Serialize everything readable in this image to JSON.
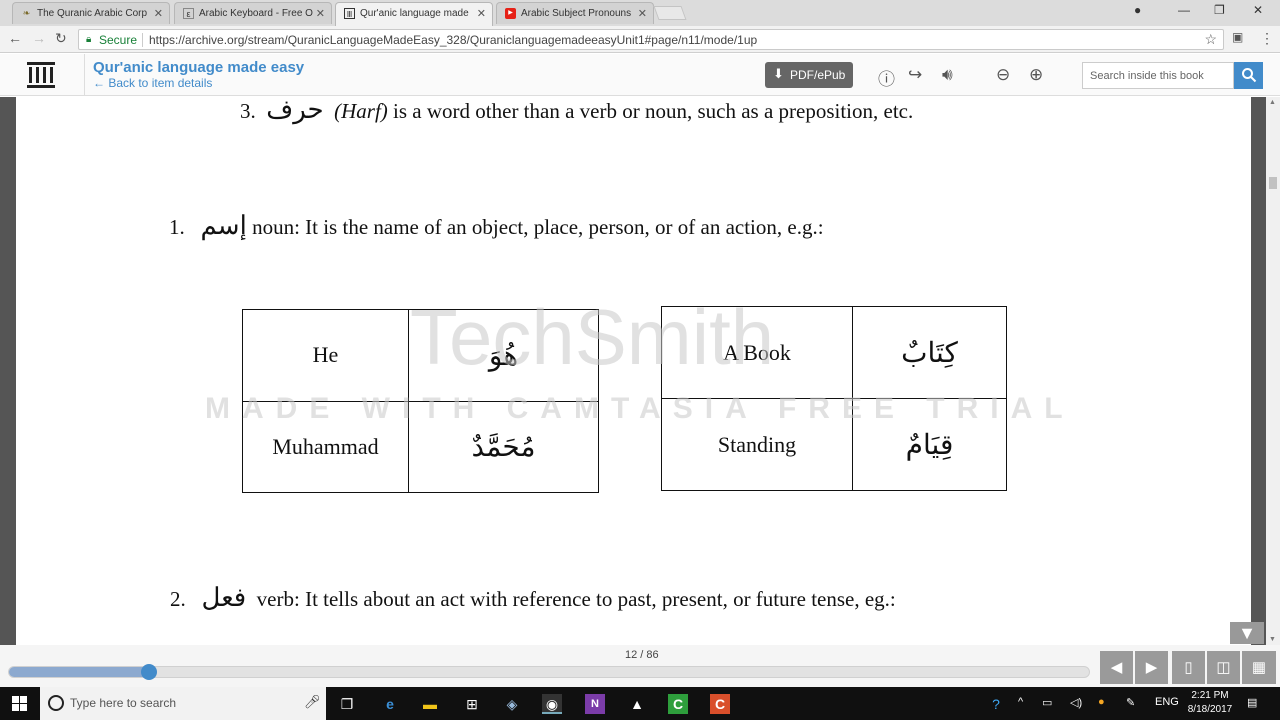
{
  "browser": {
    "tabs": [
      {
        "title": "The Quranic Arabic Corp",
        "favicon": "book-icon"
      },
      {
        "title": "Arabic Keyboard - Free O",
        "favicon": "keyboard-icon"
      },
      {
        "title": "Qur'anic language made",
        "favicon": "archive-icon"
      },
      {
        "title": "Arabic Subject Pronouns",
        "favicon": "youtube-icon"
      }
    ],
    "secure_label": "Secure",
    "url": "https://archive.org/stream/QuranicLanguageMadeEasy_328/QuraniclanguagemadeeasyUnit1#page/n11/mode/1up"
  },
  "archive": {
    "title": "Qur'anic language made easy",
    "back_link": "← Back to item details",
    "pdf_button": "PDF/ePub",
    "search_placeholder": "Search inside this book"
  },
  "book": {
    "line3_num": "3.",
    "line3_arabic": "حرف",
    "line3_italic": "(Harf)",
    "line3_text": "is a word other than a verb or noun, such as a preposition, etc.",
    "line1_num": "1.",
    "line1_arabic": "إسم",
    "line1_text": "noun:  It is the name of an object, place, person, or of an action, e.g.:",
    "table_left": [
      {
        "english": "He",
        "arabic": "هُوَ"
      },
      {
        "english": "Muhammad",
        "arabic": "مُحَمَّدٌ"
      }
    ],
    "table_right": [
      {
        "english": "A Book",
        "arabic": "كِتَابٌ"
      },
      {
        "english": "Standing",
        "arabic": "قِيَامٌ"
      }
    ],
    "line2_num": "2.",
    "line2_arabic": "فعل",
    "line2_text": "verb:  It tells about an act with reference to past, present, or future tense, eg.:"
  },
  "watermark": {
    "brand": "TechSmith",
    "caption": "MADE WITH CAMTASIA FREE TRIAL"
  },
  "viewer": {
    "page_count": "12 / 86",
    "progress_fraction": 0.13
  },
  "taskbar": {
    "search_placeholder": "Type here to search",
    "language": "ENG",
    "time": "2:21 PM",
    "date": "8/18/2017"
  }
}
